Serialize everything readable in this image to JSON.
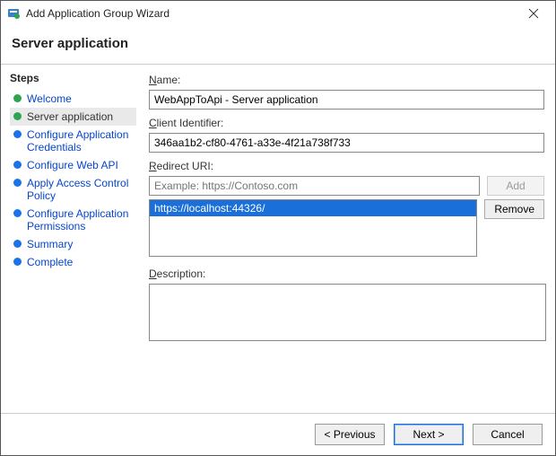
{
  "title": "Add Application Group Wizard",
  "header": "Server application",
  "sidebar": {
    "heading": "Steps",
    "items": [
      {
        "label": "Welcome",
        "state": "done",
        "link": true
      },
      {
        "label": "Server application",
        "state": "done",
        "link": false
      },
      {
        "label": "Configure Application Credentials",
        "state": "todo",
        "link": true
      },
      {
        "label": "Configure Web API",
        "state": "todo",
        "link": true
      },
      {
        "label": "Apply Access Control Policy",
        "state": "todo",
        "link": true
      },
      {
        "label": "Configure Application Permissions",
        "state": "todo",
        "link": true
      },
      {
        "label": "Summary",
        "state": "todo",
        "link": true
      },
      {
        "label": "Complete",
        "state": "todo",
        "link": true
      }
    ]
  },
  "form": {
    "name_label": "Name:",
    "name_value": "WebAppToApi - Server application",
    "client_id_label": "Client Identifier:",
    "client_id_value": "346aa1b2-cf80-4761-a33e-4f21a738f733",
    "redirect_label": "Redirect URI:",
    "redirect_placeholder": "Example: https://Contoso.com",
    "redirect_items": [
      "https://localhost:44326/"
    ],
    "add_label": "Add",
    "remove_label": "Remove",
    "desc_label": "Description:"
  },
  "footer": {
    "prev": "< Previous",
    "next": "Next >",
    "cancel": "Cancel"
  }
}
